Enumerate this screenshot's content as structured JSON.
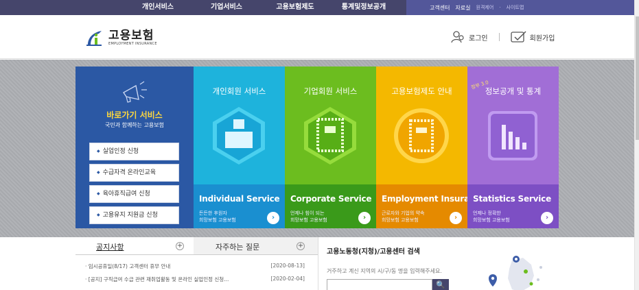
{
  "topnav": {
    "menu": [
      "개인서비스",
      "기업서비스",
      "고용보험제도",
      "통계및정보공개"
    ],
    "util": [
      "고객센터",
      "자료실"
    ],
    "util_small": [
      "원격제어",
      "사이트맵"
    ],
    "util_dot": "·"
  },
  "header": {
    "logo_ko": "고용보험",
    "logo_en": "EMPLOYMENT INSURANCE",
    "login": "로그인",
    "signup": "회원가입"
  },
  "quick": {
    "title": "바로가기 서비스",
    "sub": "국민과 함께하는 고용보험",
    "buttons": [
      "실업인정 신청",
      "수급자격 온라인교육",
      "육아휴직급여 신청",
      "고용유지 지원금 신청"
    ]
  },
  "panels": [
    {
      "title": "개인회원 서비스",
      "en": "Individual Service",
      "desc1": "든든한 후원자",
      "desc2": "희망보험 고용보험"
    },
    {
      "title": "기업회원 서비스",
      "en": "Corporate Service",
      "desc1": "언제나 힘이 되는",
      "desc2": "희망보험 고용보험"
    },
    {
      "title": "고용보험제도 안내",
      "en": "Employment Insurance",
      "desc1": "근로자와 기업의 약속",
      "desc2": "희망보험 고용보험"
    },
    {
      "title": "정보공개 및 통계",
      "en": "Statistics Service",
      "desc1": "언제나 정확한",
      "desc2": "희망보험 고용보험",
      "badge": "정부 3.0"
    }
  ],
  "panel_arrow": "›",
  "tabs": {
    "notice": "공지사항",
    "faq": "자주하는 질문",
    "plus": "+"
  },
  "notices": [
    {
      "title": "· 임시공휴일(8/17) 고객센터 휴무 안내",
      "date": "[2020-08-13]"
    },
    {
      "title": "· [공지] 구직급여 수급 관련 재취업활동 및 온라인 실업인정 신청...",
      "date": "[2020-02-04]"
    }
  ],
  "search": {
    "title": "고용노동청(지청)/고용센터 검색",
    "desc": "거주하고 계신 지역의 시/구/동 명을 입력해주세요.",
    "btn": "🔍"
  },
  "colors": {
    "navbar": "#45456b",
    "quick": "#2b58a4",
    "p1": "#1eb3dc",
    "p2": "#6cbd1f",
    "p3": "#f4b800",
    "p4": "#a16ed6"
  }
}
